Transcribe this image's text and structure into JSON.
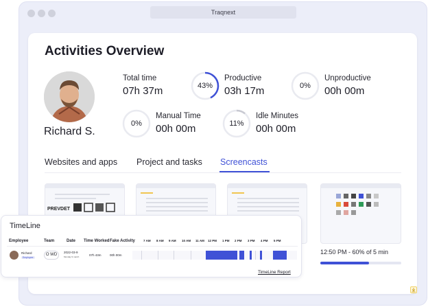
{
  "window": {
    "title": "Traqnext"
  },
  "page": {
    "title": "Activities Overview"
  },
  "user": {
    "name": "Richard S."
  },
  "stats": {
    "total_time": {
      "label": "Total time",
      "value": "07h 37m"
    },
    "productive": {
      "label": "Productive",
      "value": "03h 17m",
      "percent_label": "43%",
      "percent": 43
    },
    "unproductive": {
      "label": "Unproductive",
      "value": "00h 00m",
      "percent_label": "0%",
      "percent": 0
    },
    "manual_time": {
      "label": "Manual Time",
      "value": "00h 00m",
      "percent_label": "0%",
      "percent": 0
    },
    "idle_minutes": {
      "label": "Idle Minutes",
      "value": "00h 00m",
      "percent_label": "11%",
      "percent": 11
    }
  },
  "tabs": [
    {
      "label": "Websites and apps",
      "active": false
    },
    {
      "label": "Project and tasks",
      "active": false
    },
    {
      "label": "Screencasts",
      "active": true
    }
  ],
  "screencast": {
    "caption": "12:50 PM - 60% of 5 min",
    "progress": 0.6
  },
  "timeline": {
    "title": "TimeLine",
    "headers": [
      "Employee",
      "Team",
      "Date",
      "Time Worked",
      "Fake Activity"
    ],
    "hours": [
      "7 AM",
      "8 AM",
      "9 AM",
      "10 AM",
      "11 AM",
      "12 PM",
      "1 PM",
      "2 PM",
      "3 PM",
      "4 PM",
      "5 PM"
    ],
    "row": {
      "employee": "Richard",
      "role": "Employee",
      "team": "O WD",
      "date": "2022-03-9",
      "date_sub": "Monday 9 march",
      "time_worked": "07h 43m",
      "fake_activity": "00h 00m"
    },
    "report_link": "TimeLine Report"
  },
  "colors": {
    "accent": "#3f51d6",
    "ring_track": "#e9eaf0",
    "window_bg": "#eceef9"
  },
  "icons": {
    "corner": "download-icon"
  }
}
